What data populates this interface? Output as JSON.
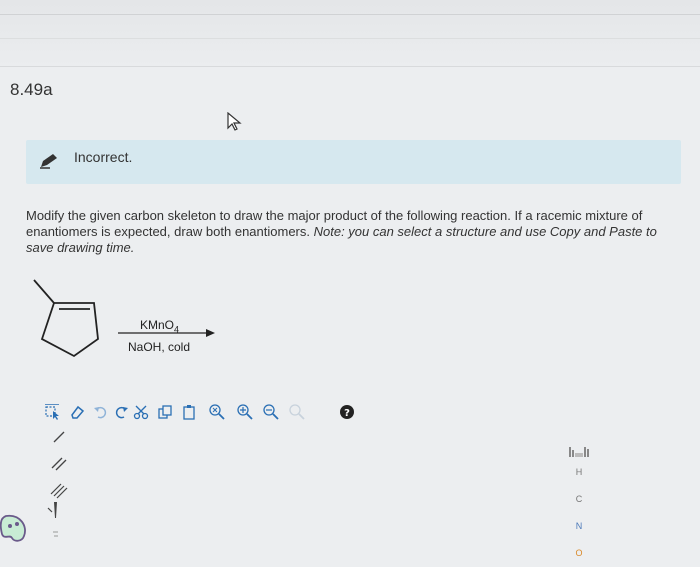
{
  "question": {
    "number": "8.49a"
  },
  "feedback": {
    "status": "Incorrect."
  },
  "prompt": {
    "main": "Modify the given carbon skeleton to draw the major product of the following reaction. If a racemic mixture of enantiomers is expected, draw both enantiomers. ",
    "note": "Note: you can select a structure and use Copy and Paste to save drawing time."
  },
  "reaction": {
    "reagent_top": "KMnO",
    "reagent_top_subscript": "4",
    "reagent_bottom": "NaOH, cold"
  },
  "atoms": [
    "H",
    "C",
    "N",
    "O"
  ],
  "colors": {
    "feedback_bg": "#d6e8ef",
    "accent_blue": "#2a6fb4",
    "atom_o": "#d98a2b",
    "atom_n": "#4a78b8"
  }
}
